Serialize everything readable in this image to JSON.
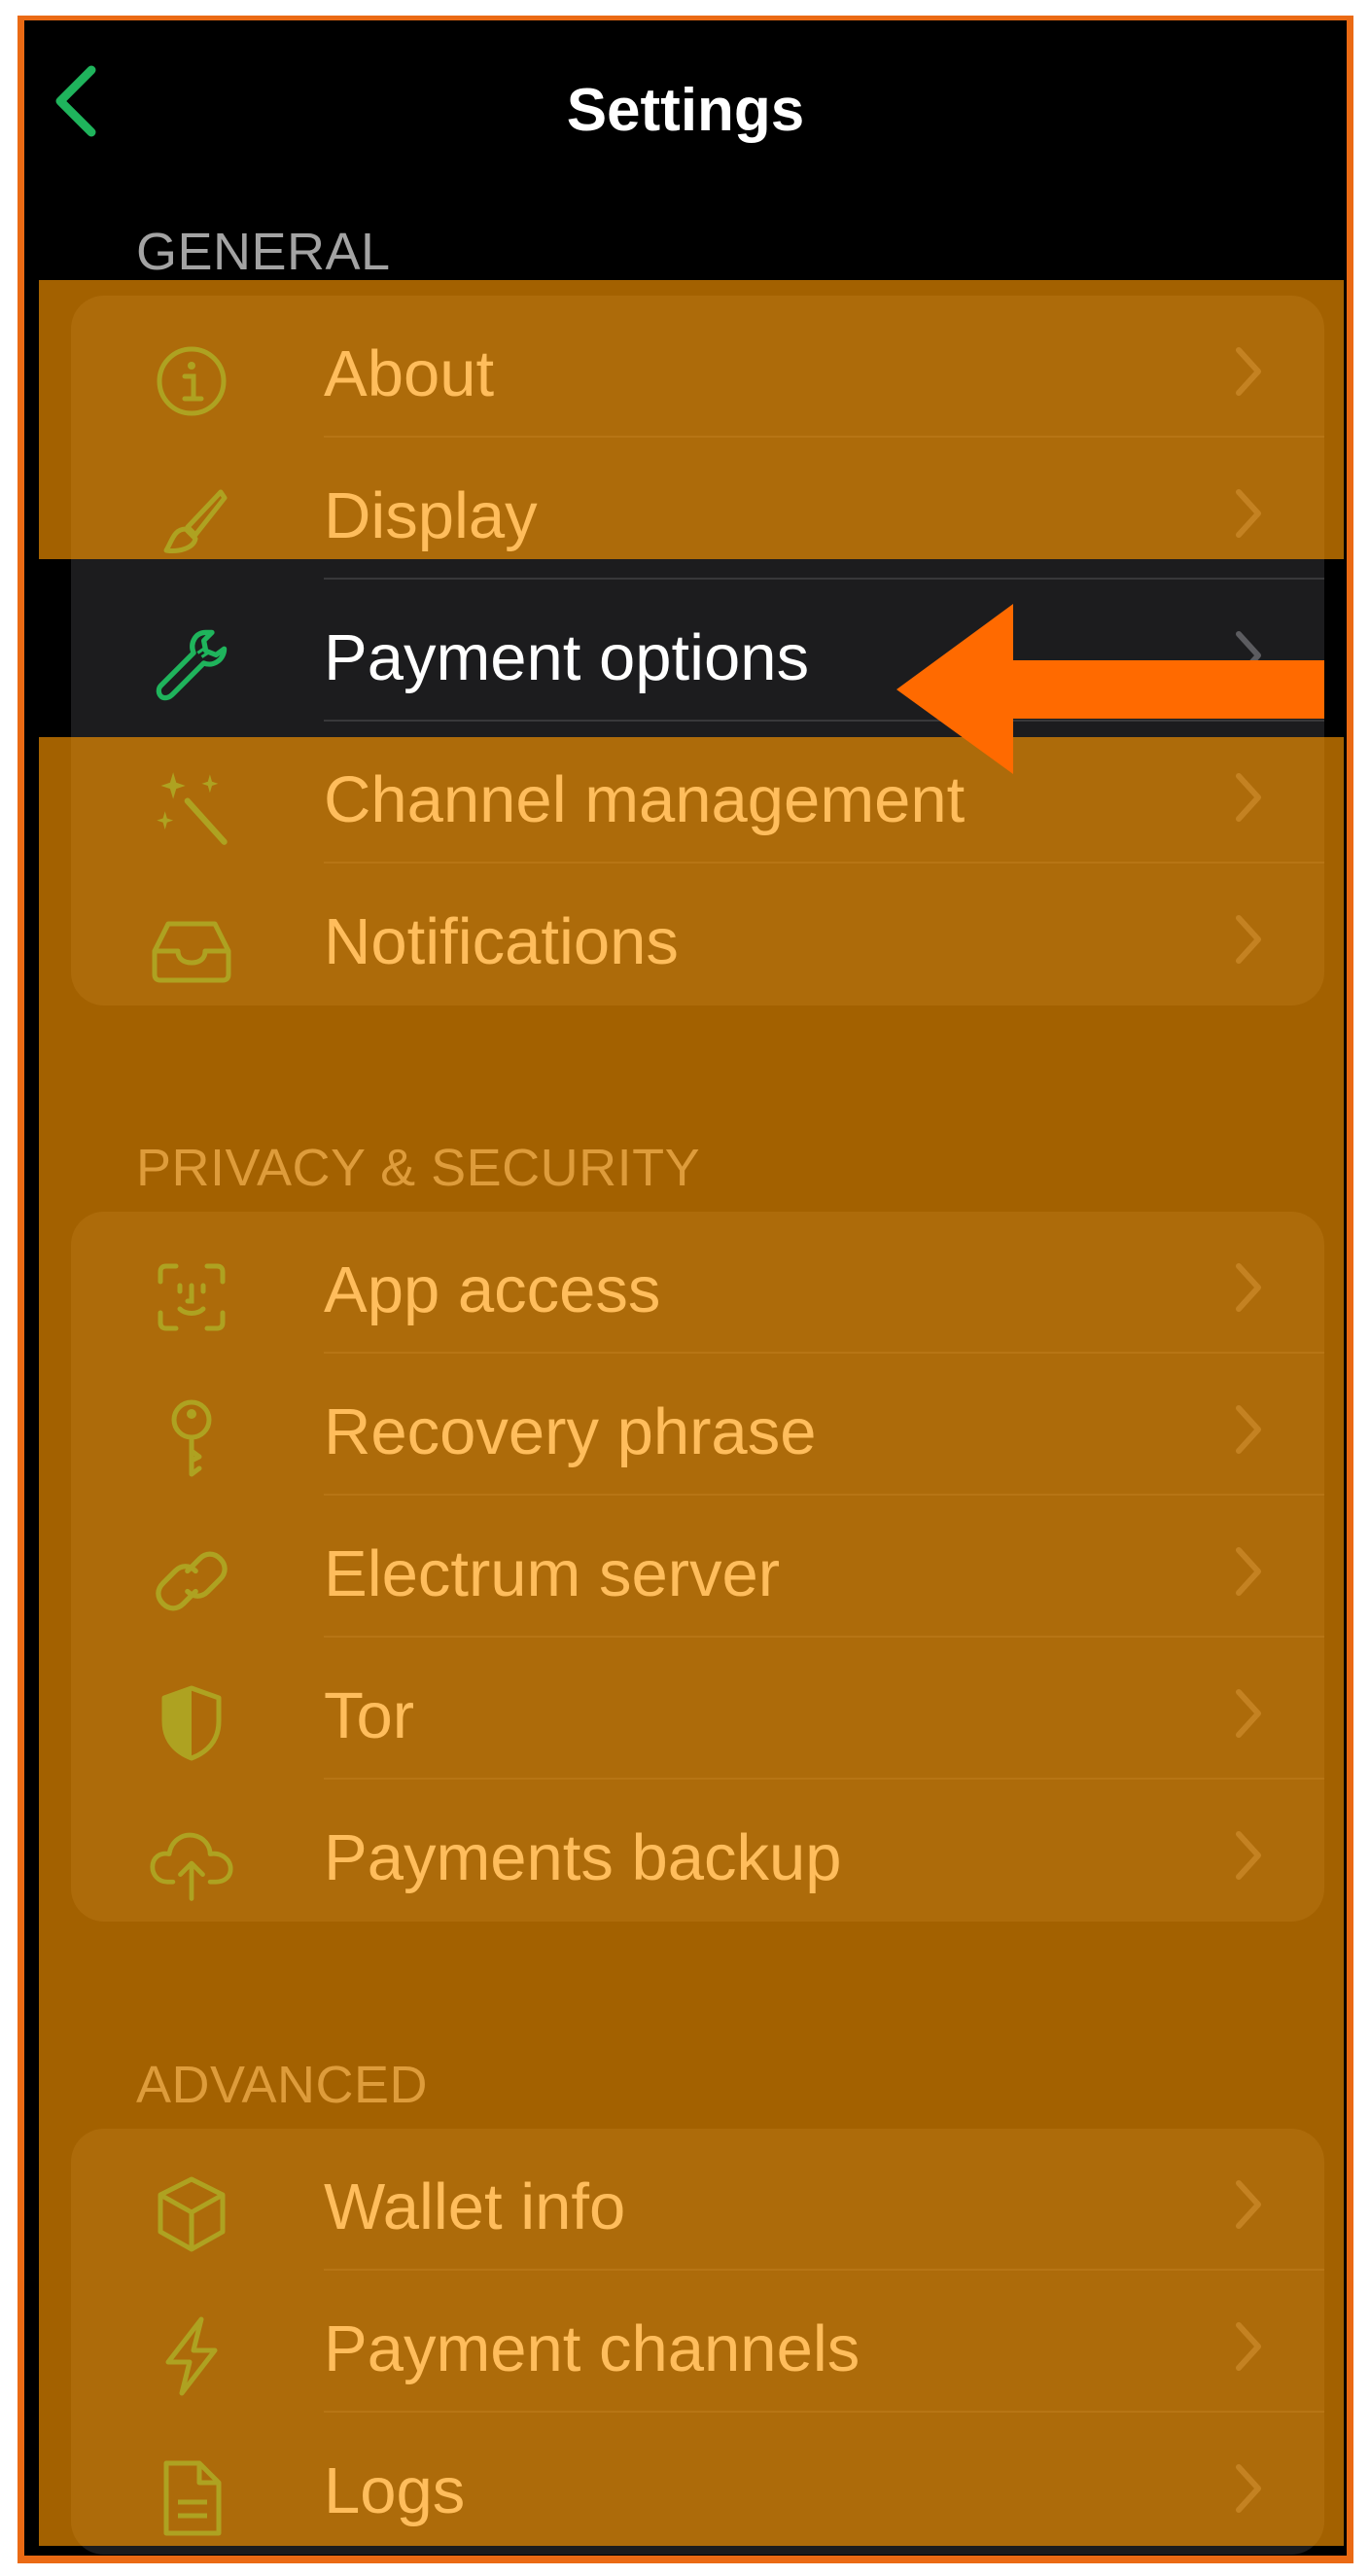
{
  "nav": {
    "title": "Settings",
    "back_icon": "chevron-left-icon"
  },
  "sections": {
    "general": {
      "header": "GENERAL",
      "items": [
        {
          "label": "About",
          "icon": "info-circle-icon"
        },
        {
          "label": "Display",
          "icon": "paintbrush-icon"
        },
        {
          "label": "Payment options",
          "icon": "wrench-icon"
        },
        {
          "label": "Channel management",
          "icon": "sparkles-icon"
        },
        {
          "label": "Notifications",
          "icon": "tray-icon"
        }
      ]
    },
    "privacy": {
      "header": "PRIVACY & SECURITY",
      "items": [
        {
          "label": "App access",
          "icon": "face-id-icon"
        },
        {
          "label": "Recovery phrase",
          "icon": "key-icon"
        },
        {
          "label": "Electrum server",
          "icon": "link-icon"
        },
        {
          "label": "Tor",
          "icon": "shield-half-icon"
        },
        {
          "label": "Payments backup",
          "icon": "cloud-upload-icon"
        }
      ]
    },
    "advanced": {
      "header": "ADVANCED",
      "items": [
        {
          "label": "Wallet info",
          "icon": "cube-icon"
        },
        {
          "label": "Payment channels",
          "icon": "bolt-icon"
        },
        {
          "label": "Logs",
          "icon": "document-icon"
        }
      ]
    }
  },
  "annotation": {
    "arrow_icon": "left-arrow-icon",
    "highlight_color": "#ff9800",
    "arrow_color": "#ff6a00"
  },
  "colors": {
    "accent": "#1fb45c",
    "background": "#000000",
    "group_background": "#1c1c1e",
    "text": "#ffffff"
  }
}
